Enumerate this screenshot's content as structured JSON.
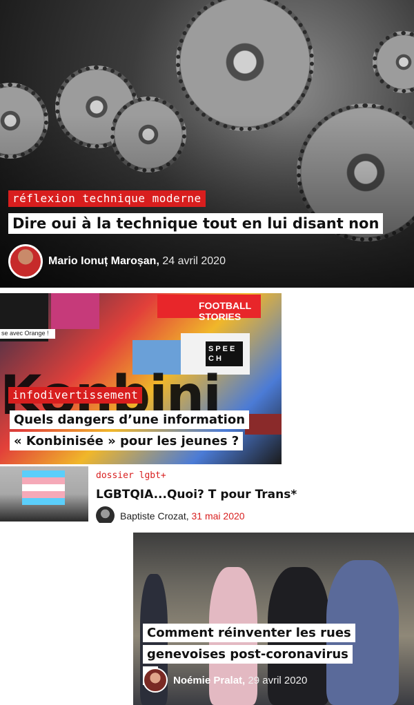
{
  "articles": [
    {
      "tag": "réflexion technique moderne",
      "title": "Dire oui à la technique tout en lui disant non",
      "author": "Mario Ionuț Maroșan,",
      "date": "24 avril 2020"
    },
    {
      "tag": "infodivertissement",
      "title": "Quels dangers d’une information « Konbinisée » pour les jeunes ?",
      "collage": {
        "big_word": "Konbini",
        "football": "FOOTBALL STORIES",
        "speech": "SPEECH",
        "orange": "se avec Orange !"
      }
    },
    {
      "tag": "dossier lgbt+",
      "title": "LGBTQIA...Quoi? T pour Trans*",
      "author": "Baptiste Crozat,",
      "date": "31 mai 2020"
    },
    {
      "title": "Comment réinventer les rues genevoises post-coronavirus ?",
      "author": "Noémie Pralat,",
      "date": "29 avril 2020"
    }
  ],
  "colors": {
    "accent": "#d81e1e",
    "title_bg": "#ffffff"
  }
}
